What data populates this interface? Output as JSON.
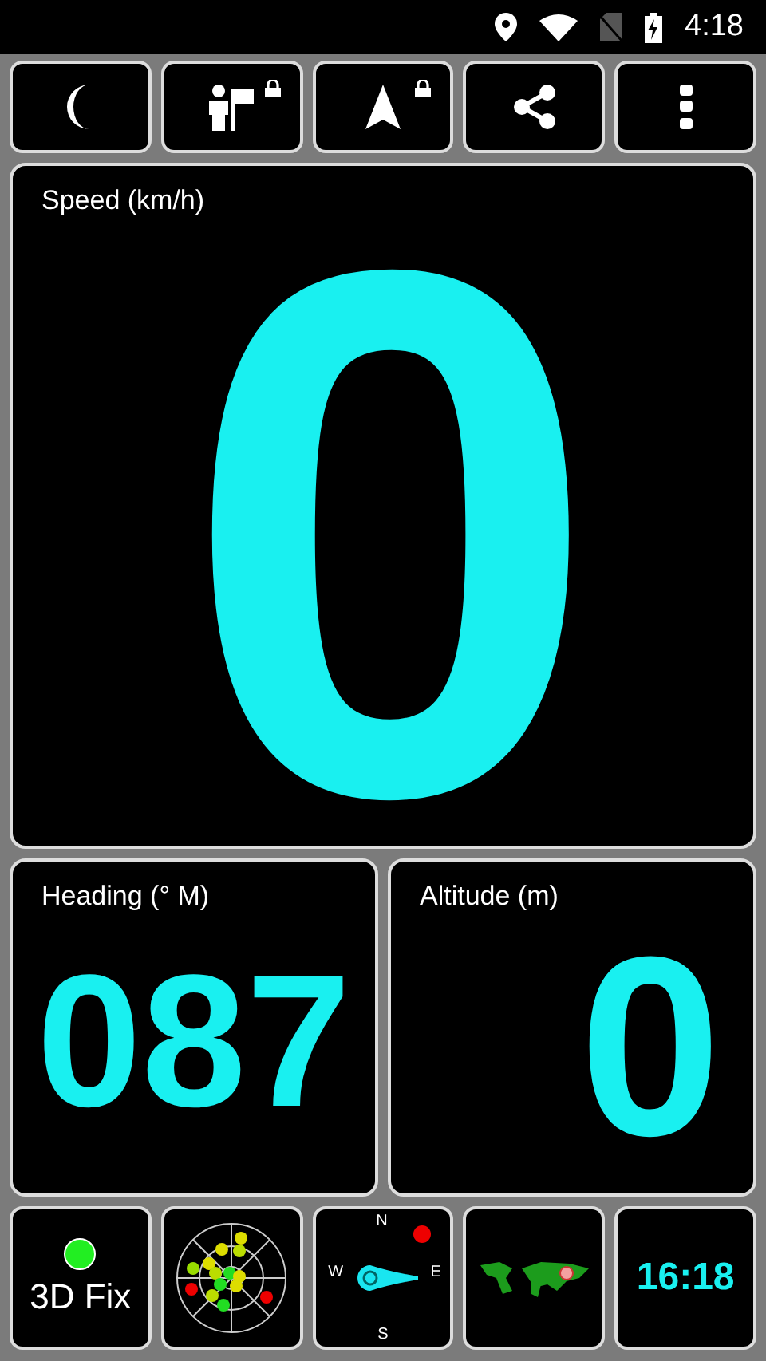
{
  "status_bar": {
    "time": "4:18"
  },
  "toolbar": [
    {
      "kind": "night",
      "locked": false
    },
    {
      "kind": "waypoint",
      "locked": true
    },
    {
      "kind": "navigate",
      "locked": true
    },
    {
      "kind": "share",
      "locked": false
    },
    {
      "kind": "menu",
      "locked": false
    }
  ],
  "speed": {
    "label": "Speed (km/h)",
    "value": "0"
  },
  "heading": {
    "label": "Heading (° M)",
    "value": "087"
  },
  "altitude": {
    "label": "Altitude (m)",
    "value": "0"
  },
  "tiles": [
    {
      "kind": "fix",
      "label": "3D Fix",
      "color": "#22ee22"
    },
    {
      "kind": "sky"
    },
    {
      "kind": "compass",
      "north": "N",
      "south": "S",
      "west": "W",
      "east": "E"
    },
    {
      "kind": "map"
    },
    {
      "kind": "clock",
      "time": "16:18"
    }
  ]
}
